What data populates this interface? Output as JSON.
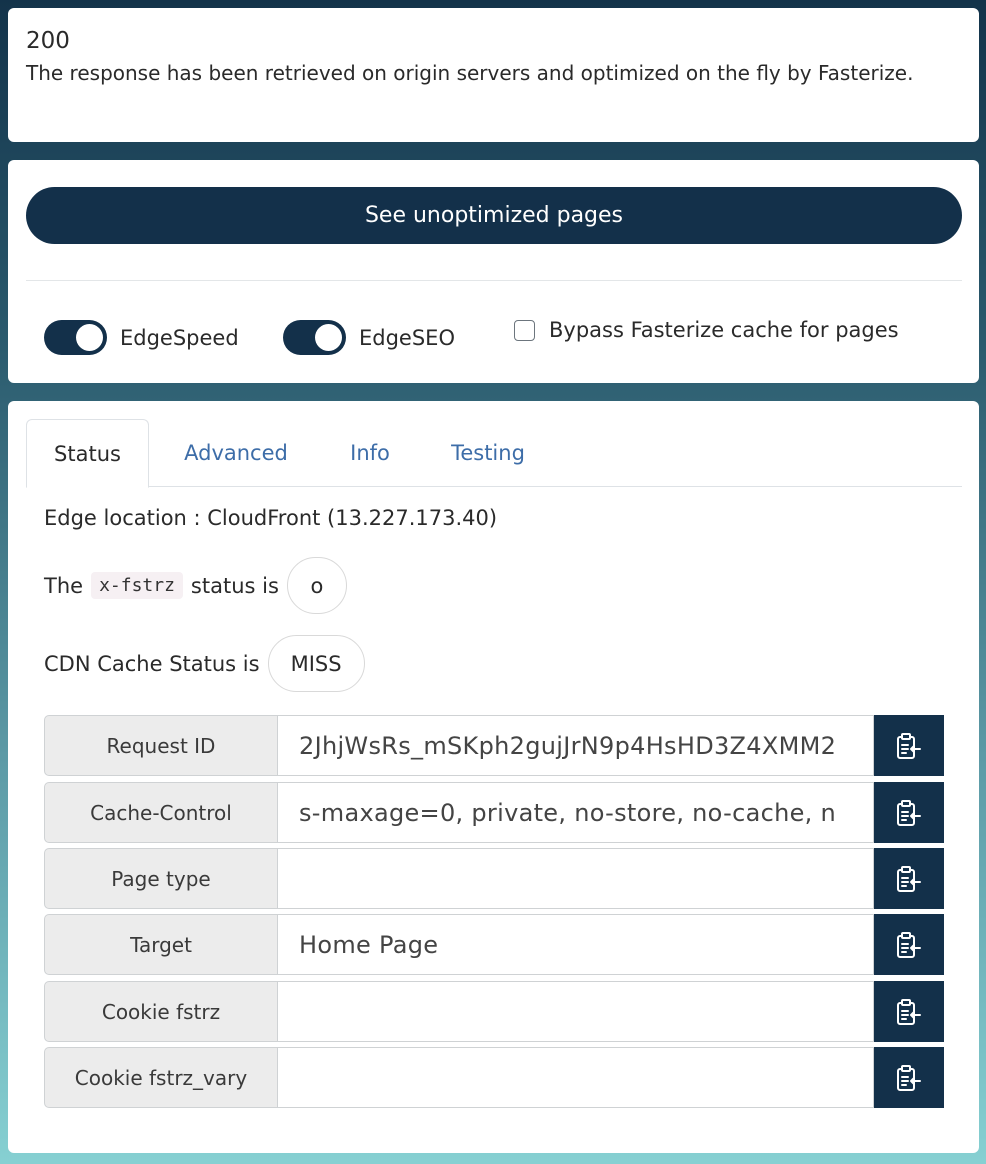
{
  "response": {
    "code": "200",
    "message": "The response has been retrieved on origin servers and optimized on the fly by Fasterize."
  },
  "controls": {
    "unoptimized_button": "See unoptimized pages",
    "edgespeed_label": "EdgeSpeed",
    "edgespeed_on": true,
    "edgeseo_label": "EdgeSEO",
    "edgeseo_on": true,
    "bypass_label": "Bypass Fasterize cache for pages",
    "bypass_checked": false
  },
  "tabs": [
    {
      "label": "Status",
      "active": true
    },
    {
      "label": "Advanced",
      "active": false
    },
    {
      "label": "Info",
      "active": false
    },
    {
      "label": "Testing",
      "active": false
    }
  ],
  "status": {
    "edge_location": "Edge location : CloudFront (13.227.173.40)",
    "fstrz_prefix": "The",
    "fstrz_code": "x-fstrz",
    "fstrz_suffix": "status is",
    "fstrz_value": "o",
    "cdn_label": "CDN Cache Status is",
    "cdn_value": "MISS"
  },
  "rows": [
    {
      "label": "Request ID",
      "value": "2JhjWsRs_mSKph2gujJrN9p4HsHD3Z4XMM2"
    },
    {
      "label": "Cache-Control",
      "value": "s-maxage=0, private, no-store, no-cache, n"
    },
    {
      "label": "Page type",
      "value": ""
    },
    {
      "label": "Target",
      "value": "Home Page"
    },
    {
      "label": "Cookie fstrz",
      "value": ""
    },
    {
      "label": "Cookie fstrz_vary",
      "value": ""
    }
  ],
  "icons": {
    "copy": "clipboard-copy-icon"
  },
  "colors": {
    "primary": "#13304a",
    "tab_link": "#3d6da8"
  }
}
